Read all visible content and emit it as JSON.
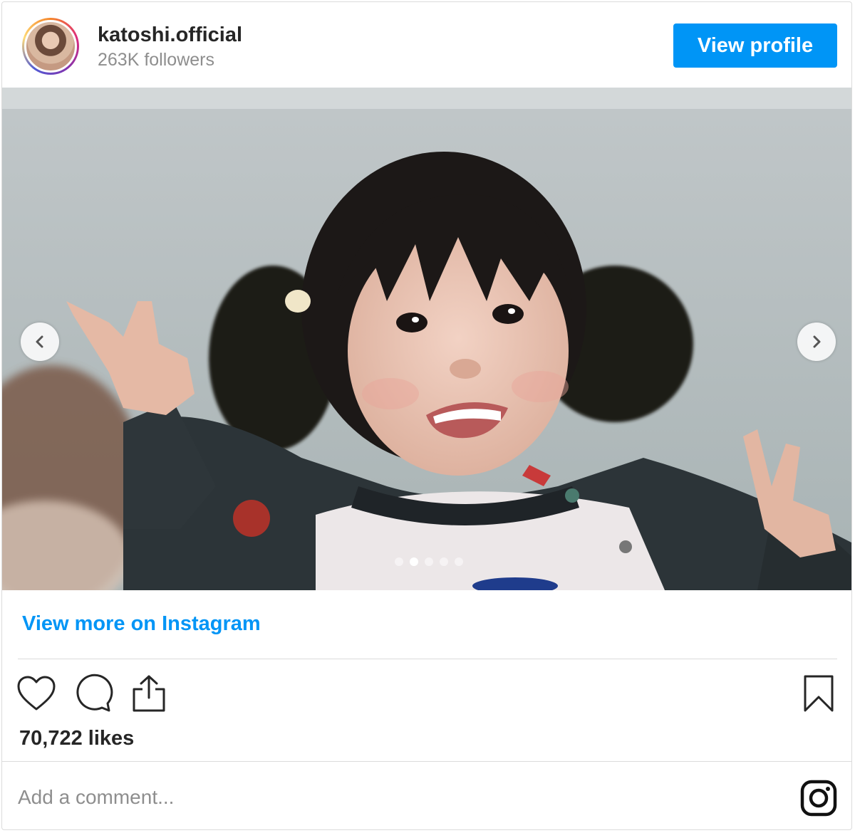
{
  "header": {
    "username": "katoshi.official",
    "followers": "263K followers",
    "view_profile_label": "View profile"
  },
  "carousel": {
    "total_slides": 5,
    "active_slide": 2,
    "prev_icon": "chevron-left-icon",
    "next_icon": "chevron-right-icon"
  },
  "view_more_label": "View more on Instagram",
  "actions": {
    "like_icon": "heart-icon",
    "comment_icon": "comment-icon",
    "share_icon": "share-icon",
    "save_icon": "bookmark-icon"
  },
  "likes_text": "70,722 likes",
  "comment": {
    "placeholder": "Add a comment..."
  },
  "colors": {
    "accent": "#0095f6",
    "text": "#262626",
    "muted": "#8e8e8e",
    "border": "#dbdbdb"
  }
}
